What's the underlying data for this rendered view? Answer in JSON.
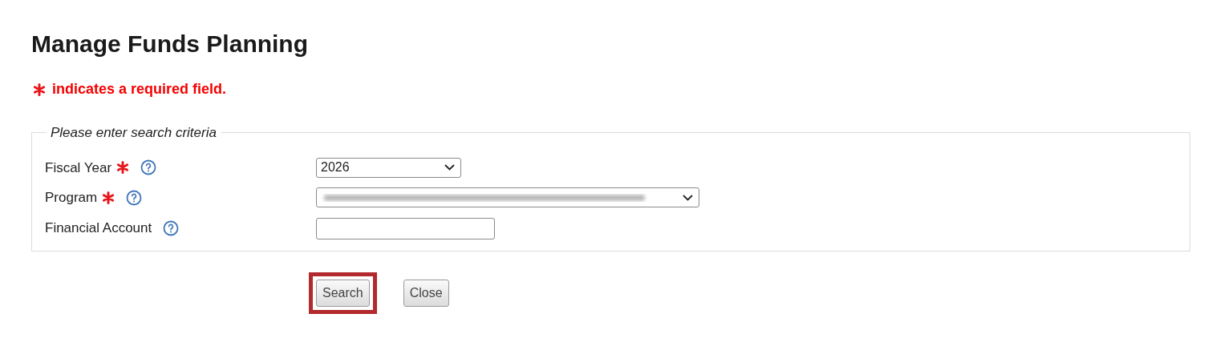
{
  "title": "Manage Funds Planning",
  "required_note": "indicates a required field.",
  "criteria": {
    "legend": "Please enter search criteria",
    "fields": [
      {
        "label": "Fiscal Year",
        "required": true,
        "kind": "select",
        "value": "2026"
      },
      {
        "label": "Program",
        "required": true,
        "kind": "select",
        "value_blurred": true
      },
      {
        "label": "Financial Account",
        "required": false,
        "kind": "text"
      }
    ]
  },
  "buttons": [
    {
      "label": "Search",
      "highlighted": true
    },
    {
      "label": "Close",
      "highlighted": false
    }
  ]
}
